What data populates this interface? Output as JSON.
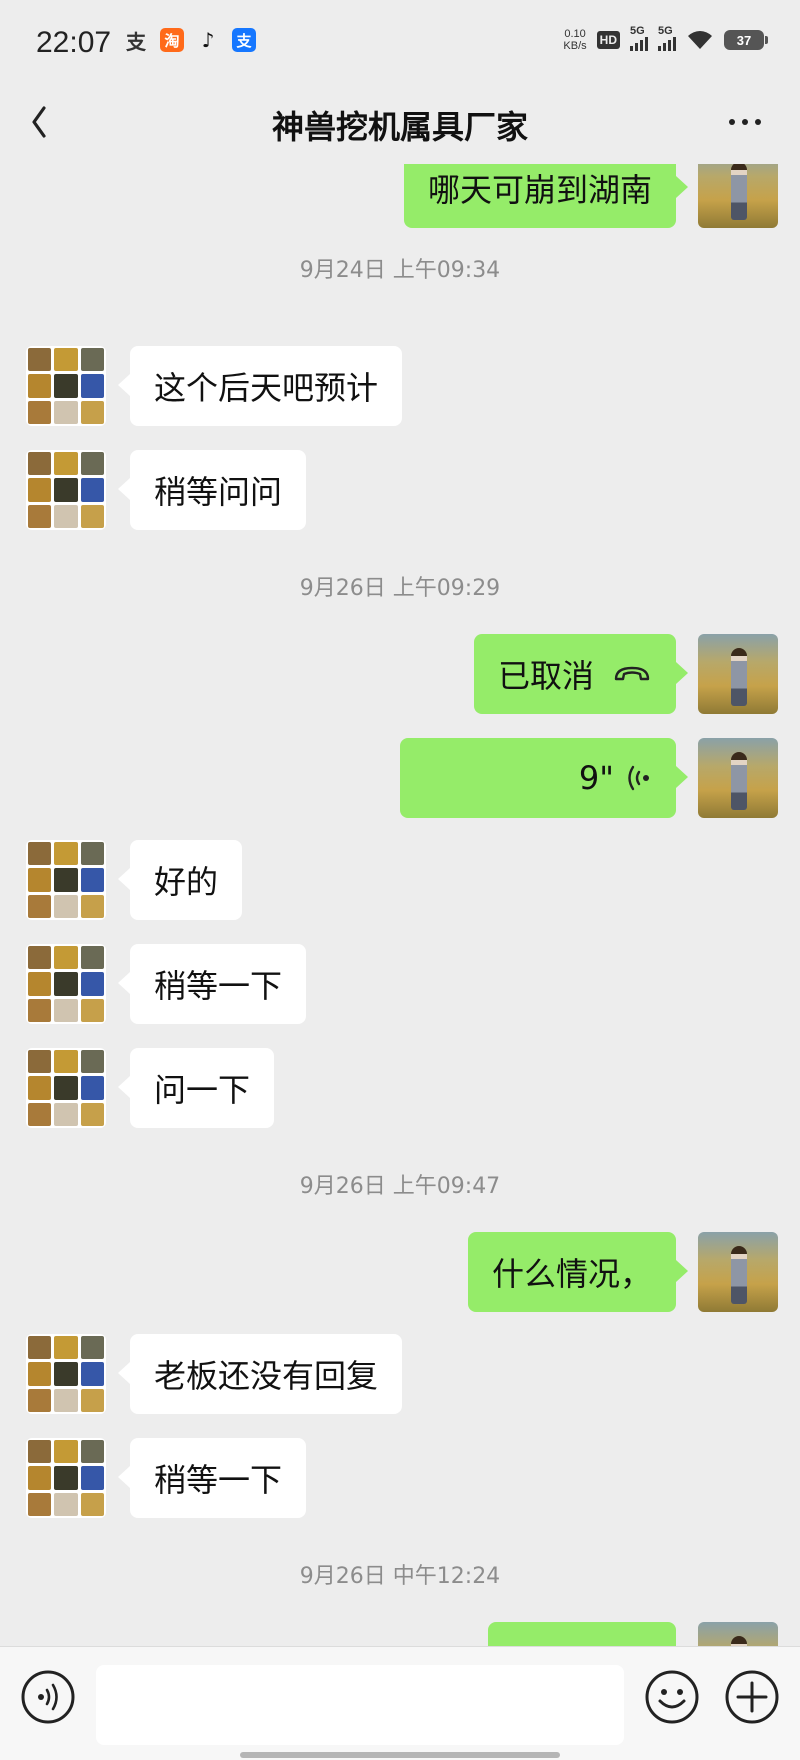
{
  "status_bar": {
    "time": "22:07",
    "app_icons": [
      "alipay-icon",
      "taobao-icon",
      "tiktok-icon",
      "alipay-blue-icon"
    ],
    "net_speed_value": "0.10",
    "net_speed_unit": "KB/s",
    "hd_label": "HD",
    "sim1_label": "5G",
    "sim2_label": "5G",
    "battery": "37"
  },
  "header": {
    "title": "神兽挖机属具厂家"
  },
  "messages": [
    {
      "type": "self_text",
      "text": "哪天可崩到湖南"
    },
    {
      "type": "timestamp",
      "text": "9月24日 上午09:34"
    },
    {
      "type": "other_text",
      "text": "这个后天吧预计"
    },
    {
      "type": "other_text",
      "text": "稍等问问"
    },
    {
      "type": "timestamp",
      "text": "9月26日 上午09:29"
    },
    {
      "type": "self_call",
      "text": "已取消",
      "icon": "phone-hangup-icon"
    },
    {
      "type": "self_voice",
      "text": "9\"",
      "icon": "voice-wave-icon"
    },
    {
      "type": "other_text",
      "text": "好的"
    },
    {
      "type": "other_text",
      "text": "稍等一下"
    },
    {
      "type": "other_text",
      "text": "问一下"
    },
    {
      "type": "timestamp",
      "text": "9月26日 上午09:47"
    },
    {
      "type": "self_text",
      "text": "什么情况，"
    },
    {
      "type": "other_text",
      "text": "老板还没有回复"
    },
    {
      "type": "other_text",
      "text": "稍等一下"
    },
    {
      "type": "timestamp",
      "text": "9月26日 中午12:24"
    }
  ],
  "input_bar": {
    "placeholder": ""
  },
  "colors": {
    "self_bubble": "#95ec69",
    "other_bubble": "#ffffff",
    "background": "#ededed"
  }
}
